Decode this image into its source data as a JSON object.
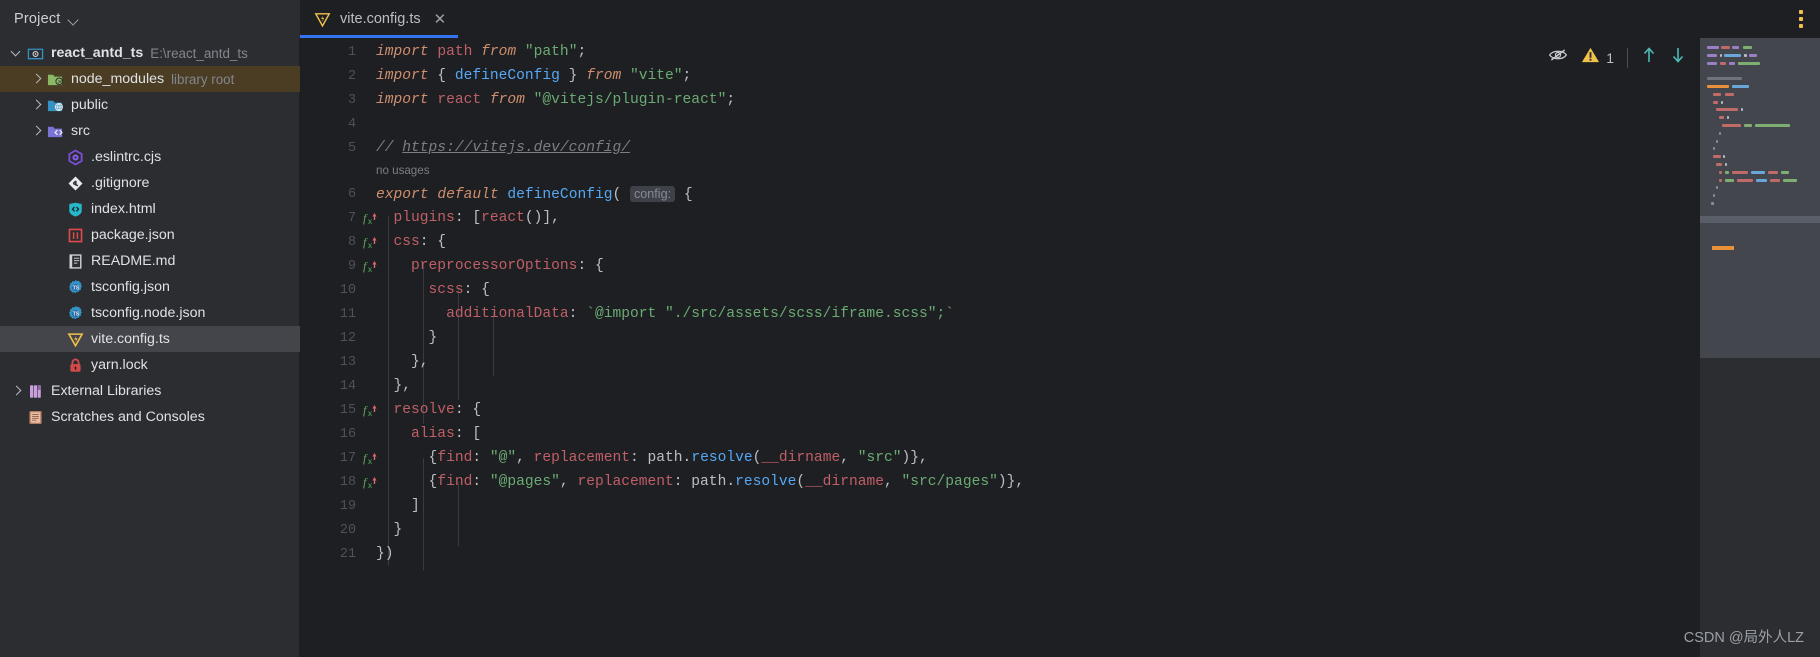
{
  "window": {
    "theme_bg": "#2b2d30",
    "editor_bg": "#1e1f22",
    "accent": "#3574f0"
  },
  "sidebar": {
    "panel_title": "Project",
    "panel_chevron_icon": "chevron-down-icon",
    "items": [
      {
        "label": "react_antd_ts",
        "sub": "E:\\react_antd_ts",
        "icon": "project-module-icon",
        "depth": 0,
        "arrow": "open",
        "bold": true,
        "state": ""
      },
      {
        "label": "node_modules",
        "sub": "library root",
        "icon": "folder-library-icon",
        "depth": 1,
        "arrow": "closed",
        "bold": false,
        "state": "brown"
      },
      {
        "label": "public",
        "sub": "",
        "icon": "folder-web-icon",
        "depth": 1,
        "arrow": "closed",
        "bold": false,
        "state": ""
      },
      {
        "label": "src",
        "sub": "",
        "icon": "folder-source-icon",
        "depth": 1,
        "arrow": "closed",
        "bold": false,
        "state": ""
      },
      {
        "label": ".eslintrc.cjs",
        "sub": "",
        "icon": "eslint-icon",
        "depth": 2,
        "arrow": "",
        "bold": false,
        "state": ""
      },
      {
        "label": ".gitignore",
        "sub": "",
        "icon": "git-icon",
        "depth": 2,
        "arrow": "",
        "bold": false,
        "state": ""
      },
      {
        "label": "index.html",
        "sub": "",
        "icon": "html-icon",
        "depth": 2,
        "arrow": "",
        "bold": false,
        "state": ""
      },
      {
        "label": "package.json",
        "sub": "",
        "icon": "npm-json-icon",
        "depth": 2,
        "arrow": "",
        "bold": false,
        "state": ""
      },
      {
        "label": "README.md",
        "sub": "",
        "icon": "markdown-icon",
        "depth": 2,
        "arrow": "",
        "bold": false,
        "state": ""
      },
      {
        "label": "tsconfig.json",
        "sub": "",
        "icon": "typescript-config-icon",
        "depth": 2,
        "arrow": "",
        "bold": false,
        "state": ""
      },
      {
        "label": "tsconfig.node.json",
        "sub": "",
        "icon": "typescript-config-icon",
        "depth": 2,
        "arrow": "",
        "bold": false,
        "state": ""
      },
      {
        "label": "vite.config.ts",
        "sub": "",
        "icon": "vite-icon",
        "depth": 2,
        "arrow": "",
        "bold": false,
        "state": "selected"
      },
      {
        "label": "yarn.lock",
        "sub": "",
        "icon": "lock-icon",
        "depth": 2,
        "arrow": "",
        "bold": false,
        "state": ""
      },
      {
        "label": "External Libraries",
        "sub": "",
        "icon": "libraries-icon",
        "depth": 0,
        "arrow": "closed",
        "bold": false,
        "state": ""
      },
      {
        "label": "Scratches and Consoles",
        "sub": "",
        "icon": "scratches-icon",
        "depth": 0,
        "arrow": "",
        "bold": false,
        "state": ""
      }
    ]
  },
  "tabs": [
    {
      "label": "vite.config.ts",
      "icon": "vite-icon",
      "close_icon": "close-icon",
      "active": true
    }
  ],
  "toolbar": {
    "kebab_icon": "more-vertical-icon"
  },
  "inspections": {
    "eye_icon": "eye-off-icon",
    "warning_icon": "warning-triangle-icon",
    "warning_count": "1",
    "prev_icon": "arrow-up-icon",
    "next_icon": "arrow-down-icon"
  },
  "watermark": "CSDN @局外人LZ",
  "editor": {
    "filename": "vite.config.ts",
    "line_numbers": [
      "1",
      "2",
      "3",
      "4",
      "5",
      "6",
      "7",
      "8",
      "9",
      "10",
      "11",
      "12",
      "13",
      "14",
      "15",
      "16",
      "17",
      "18",
      "19",
      "20",
      "21"
    ],
    "gutter_fx_lines": [
      "7",
      "8",
      "9",
      "15",
      "17",
      "18"
    ],
    "inlay_hint": "config:",
    "usage_hint": "no usages",
    "lines": [
      {
        "n": "1",
        "text": "import path from \"path\";"
      },
      {
        "n": "2",
        "text": "import { defineConfig } from \"vite\";"
      },
      {
        "n": "3",
        "text": "import react from \"@vitejs/plugin-react\";"
      },
      {
        "n": "4",
        "text": ""
      },
      {
        "n": "5",
        "text": "// https://vitejs.dev/config/"
      },
      {
        "n": "6",
        "text": "export default defineConfig( config: {"
      },
      {
        "n": "7",
        "text": "  plugins: [react()],"
      },
      {
        "n": "8",
        "text": "  css: {"
      },
      {
        "n": "9",
        "text": "    preprocessorOptions: {"
      },
      {
        "n": "10",
        "text": "      scss: {"
      },
      {
        "n": "11",
        "text": "        additionalData: `@import \"./src/assets/scss/iframe.scss\";`"
      },
      {
        "n": "12",
        "text": "      }"
      },
      {
        "n": "13",
        "text": "    },"
      },
      {
        "n": "14",
        "text": "  },"
      },
      {
        "n": "15",
        "text": "  resolve: {"
      },
      {
        "n": "16",
        "text": "    alias: ["
      },
      {
        "n": "17",
        "text": "      {find: \"@\", replacement: path.resolve(__dirname, \"src\")},"
      },
      {
        "n": "18",
        "text": "      {find: \"@pages\", replacement: path.resolve(__dirname, \"src/pages\")},"
      },
      {
        "n": "19",
        "text": "    ]"
      },
      {
        "n": "20",
        "text": "  }"
      },
      {
        "n": "21",
        "text": "})"
      }
    ]
  }
}
